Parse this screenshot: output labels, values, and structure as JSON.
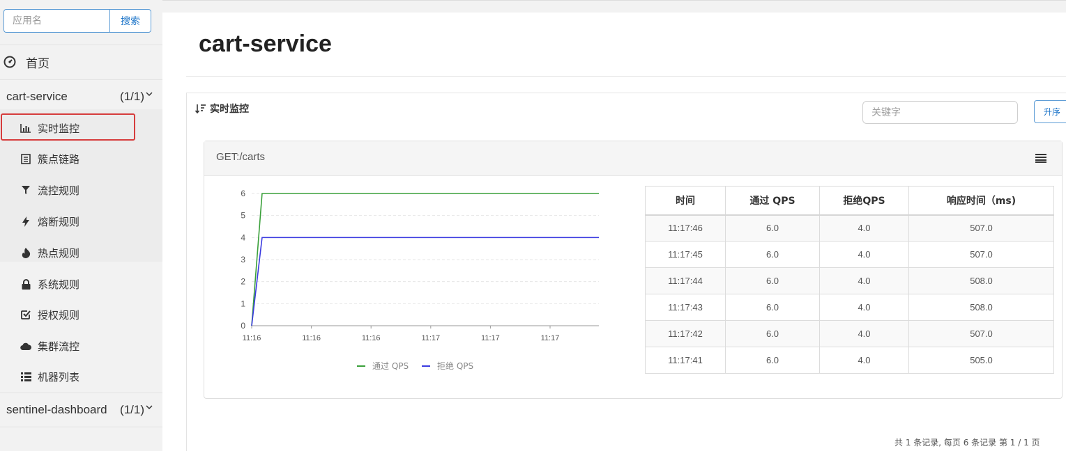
{
  "sidebar": {
    "search_placeholder": "应用名",
    "search_button": "搜索",
    "home_label": "首页",
    "apps": [
      {
        "name": "cart-service",
        "count": "(1/1)"
      },
      {
        "name": "sentinel-dashboard",
        "count": "(1/1)"
      }
    ],
    "menu": [
      {
        "label": "实时监控",
        "icon": "bar-chart-icon",
        "active": true
      },
      {
        "label": "簇点链路",
        "icon": "list-icon"
      },
      {
        "label": "流控规则",
        "icon": "filter-icon"
      },
      {
        "label": "熔断规则",
        "icon": "bolt-icon"
      },
      {
        "label": "热点规则",
        "icon": "fire-icon"
      },
      {
        "label": "系统规则",
        "icon": "lock-icon"
      },
      {
        "label": "授权规则",
        "icon": "check-square-icon"
      },
      {
        "label": "集群流控",
        "icon": "cloud-icon"
      },
      {
        "label": "机器列表",
        "icon": "list-ul-icon"
      }
    ]
  },
  "page": {
    "title": "cart-service",
    "panel_title": "实时监控",
    "keyword_placeholder": "关键字",
    "sort_button": "升序",
    "footer": "共 1 条记录, 每页 6 条记录 第 1 / 1 页"
  },
  "resource": {
    "name": "GET:/carts",
    "table": {
      "headers": [
        "时间",
        "通过 QPS",
        "拒绝QPS",
        "响应时间（ms)"
      ],
      "rows": [
        [
          "11:17:46",
          "6.0",
          "4.0",
          "507.0"
        ],
        [
          "11:17:45",
          "6.0",
          "4.0",
          "507.0"
        ],
        [
          "11:17:44",
          "6.0",
          "4.0",
          "508.0"
        ],
        [
          "11:17:43",
          "6.0",
          "4.0",
          "508.0"
        ],
        [
          "11:17:42",
          "6.0",
          "4.0",
          "507.0"
        ],
        [
          "11:17:41",
          "6.0",
          "4.0",
          "505.0"
        ]
      ]
    }
  },
  "chart_data": {
    "type": "line",
    "x": [
      "11:16",
      "11:16",
      "11:16",
      "11:17",
      "11:17",
      "11:17"
    ],
    "ylim": [
      0,
      6
    ],
    "yticks": [
      0,
      1,
      2,
      3,
      4,
      5,
      6
    ],
    "grid": true,
    "legend_position": "bottom",
    "series": [
      {
        "name": "通过 QPS",
        "color": "#3aa03a",
        "points": [
          [
            0,
            0
          ],
          [
            0.03,
            6
          ],
          [
            1,
            6
          ]
        ]
      },
      {
        "name": "拒绝 QPS",
        "color": "#3b3be0",
        "points": [
          [
            0,
            0
          ],
          [
            0.03,
            4
          ],
          [
            1,
            4
          ]
        ]
      }
    ]
  }
}
